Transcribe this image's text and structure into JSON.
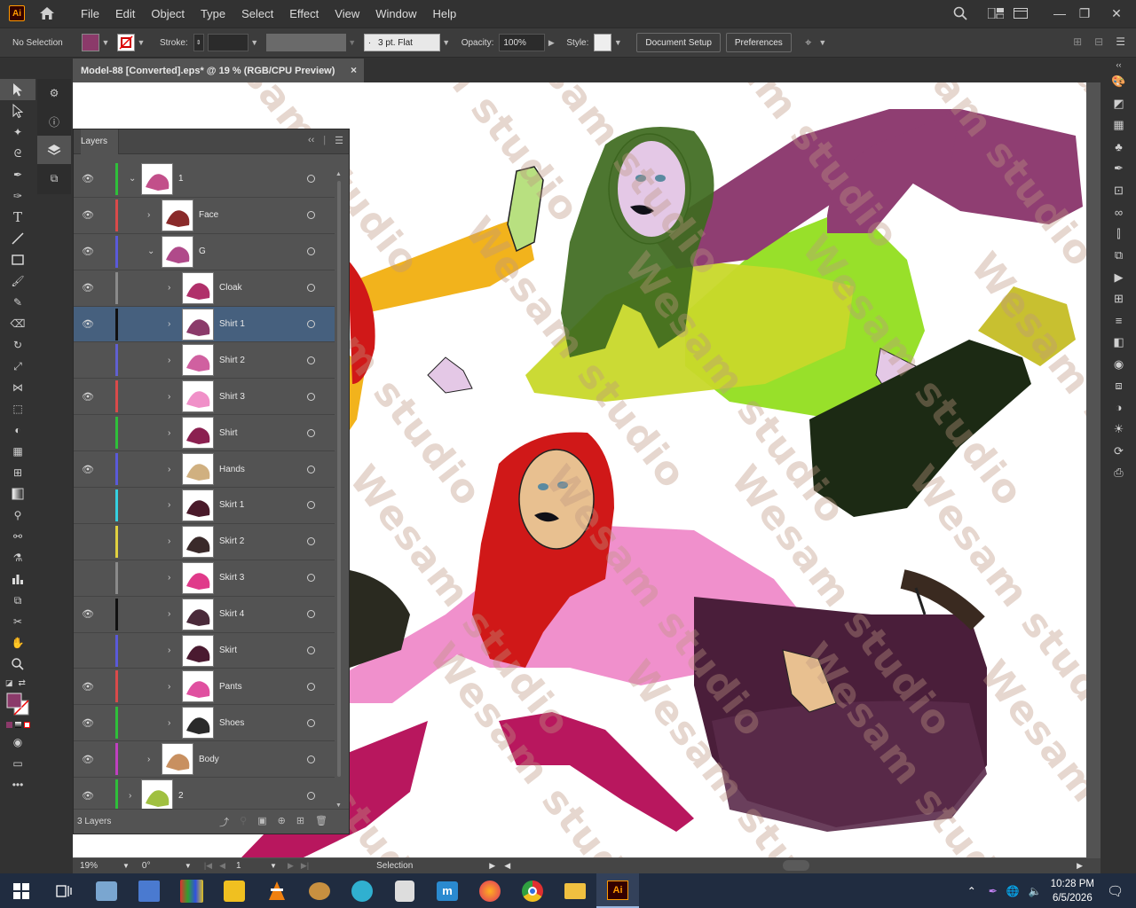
{
  "app": {
    "logo": "Ai"
  },
  "menu": [
    "File",
    "Edit",
    "Object",
    "Type",
    "Select",
    "Effect",
    "View",
    "Window",
    "Help"
  ],
  "control": {
    "selection": "No Selection",
    "fill_color": "#8b3a6a",
    "stroke_label": "Stroke:",
    "brush": "3 pt. Flat",
    "opacity_label": "Opacity:",
    "opacity_value": "100%",
    "style_label": "Style:",
    "document_setup": "Document Setup",
    "preferences": "Preferences"
  },
  "document": {
    "tab_title": "Model-88 [Converted].eps* @ 19 % (RGB/CPU Preview)",
    "close": "×"
  },
  "layers_panel": {
    "title": "Layers",
    "footer_count": "3 Layers",
    "rows": [
      {
        "name": "1",
        "bar": "#2fbf3a",
        "eye": true,
        "chev": "v",
        "indent": 0,
        "thumb": "#c24f8a"
      },
      {
        "name": "Face",
        "bar": "#d94a4a",
        "eye": true,
        "chev": ">",
        "indent": 1,
        "thumb": "#8a2a2a"
      },
      {
        "name": "G",
        "bar": "#5a5ad9",
        "eye": true,
        "chev": "v",
        "indent": 1,
        "thumb": "#b04a8a"
      },
      {
        "name": "Cloak",
        "bar": "#8a8a8a",
        "eye": true,
        "chev": ">",
        "indent": 2,
        "thumb": "#b0306a"
      },
      {
        "name": "Shirt 1",
        "bar": "#111111",
        "eye": true,
        "chev": ">",
        "indent": 2,
        "thumb": "#8b3a6a",
        "selected": true
      },
      {
        "name": "Shirt 2",
        "bar": "#6060d0",
        "eye": false,
        "chev": ">",
        "indent": 2,
        "thumb": "#d060a0"
      },
      {
        "name": "Shirt 3",
        "bar": "#d94a4a",
        "eye": true,
        "chev": ">",
        "indent": 2,
        "thumb": "#f090c8"
      },
      {
        "name": "Shirt",
        "bar": "#2fbf3a",
        "eye": false,
        "chev": ">",
        "indent": 2,
        "thumb": "#8b2050"
      },
      {
        "name": "Hands",
        "bar": "#5a5ad9",
        "eye": true,
        "chev": ">",
        "indent": 2,
        "thumb": "#d0b080"
      },
      {
        "name": "Skirt 1",
        "bar": "#35d0e0",
        "eye": false,
        "chev": ">",
        "indent": 2,
        "thumb": "#4a1a2a"
      },
      {
        "name": "Skirt 2",
        "bar": "#e0d040",
        "eye": false,
        "chev": ">",
        "indent": 2,
        "thumb": "#3a2a2a"
      },
      {
        "name": "Skirt 3",
        "bar": "#8a8a8a",
        "eye": false,
        "chev": ">",
        "indent": 2,
        "thumb": "#e03a8a"
      },
      {
        "name": "Skirt 4",
        "bar": "#111111",
        "eye": true,
        "chev": ">",
        "indent": 2,
        "thumb": "#4a2a3a"
      },
      {
        "name": "Skirt",
        "bar": "#5a5ad9",
        "eye": false,
        "chev": ">",
        "indent": 2,
        "thumb": "#4a1a30"
      },
      {
        "name": "Pants",
        "bar": "#d94a4a",
        "eye": true,
        "chev": ">",
        "indent": 2,
        "thumb": "#e050a0"
      },
      {
        "name": "Shoes",
        "bar": "#2fbf3a",
        "eye": true,
        "chev": ">",
        "indent": 2,
        "thumb": "#2a2a2a"
      },
      {
        "name": "Body",
        "bar": "#c040c0",
        "eye": true,
        "chev": ">",
        "indent": 1,
        "thumb": "#c89060"
      },
      {
        "name": "2",
        "bar": "#2fbf3a",
        "eye": true,
        "chev": ">",
        "indent": 0,
        "thumb": "#a0c040"
      }
    ]
  },
  "status": {
    "zoom": "19%",
    "rotation": "0°",
    "artboard": "1",
    "tool": "Selection"
  },
  "watermark": "Wesam studio",
  "taskbar": {
    "time": "10:28 PM",
    "date": "6/5/2026"
  }
}
